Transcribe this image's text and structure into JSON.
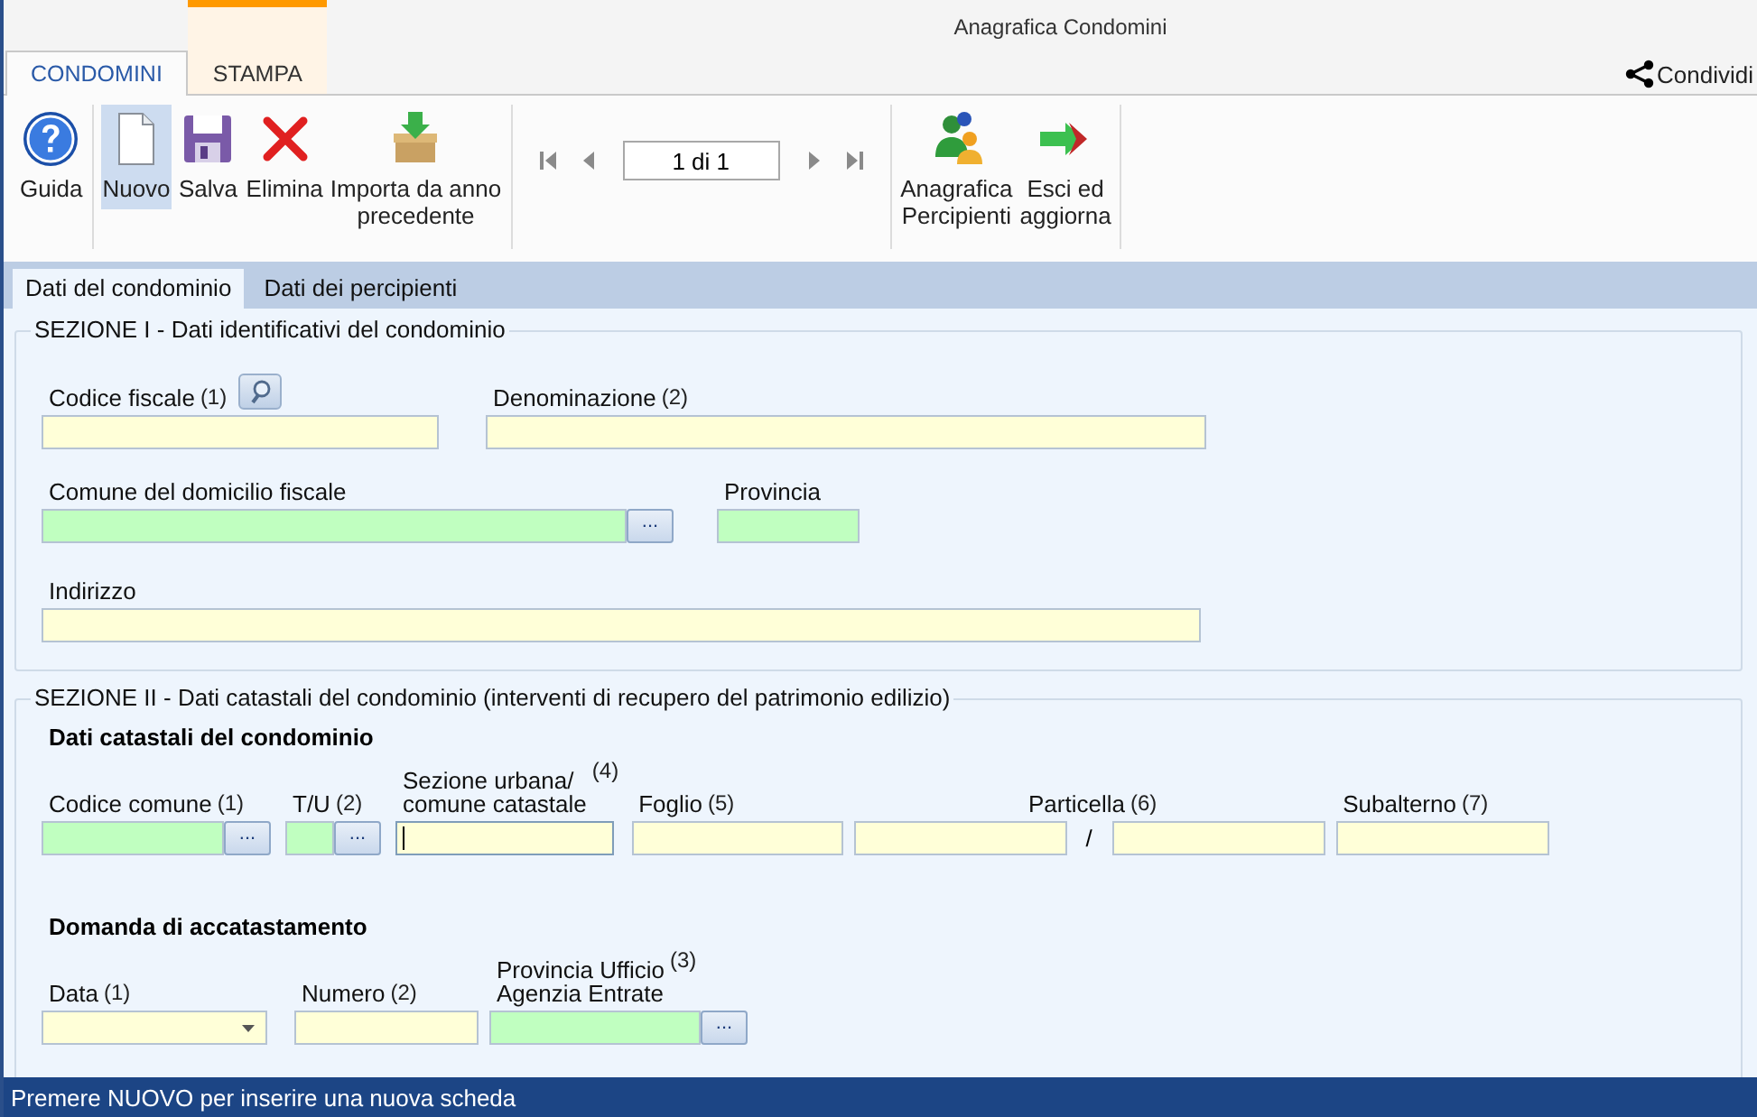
{
  "window": {
    "title": "Anagrafica Condomini"
  },
  "ribbon_tabs": [
    {
      "label": "CONDOMINI",
      "selected": true,
      "accent": false
    },
    {
      "label": "STAMPA",
      "selected": false,
      "accent": true
    }
  ],
  "share": {
    "label": "Condividi"
  },
  "toolbar_groups": [
    {
      "kind": "buttons",
      "buttons": [
        {
          "label": "Guida",
          "pressed": false
        }
      ]
    },
    {
      "kind": "buttons",
      "buttons": [
        {
          "label": "Nuovo",
          "pressed": true
        },
        {
          "label": "Salva",
          "pressed": false
        },
        {
          "label": "Elimina",
          "pressed": false
        },
        {
          "label": "Importa da anno\nprecedente",
          "pressed": false
        }
      ]
    },
    {
      "kind": "pager",
      "value": "1 di 1"
    },
    {
      "kind": "buttons",
      "buttons": [
        {
          "label": "Anagrafica\nPercipienti",
          "pressed": false
        },
        {
          "label": "Esci ed\naggiorna",
          "pressed": false
        }
      ]
    }
  ],
  "form_tabs": [
    {
      "label": "Dati del condominio",
      "selected": true
    },
    {
      "label": "Dati dei percipienti",
      "selected": false
    }
  ],
  "sections": [
    {
      "title": "SEZIONE I - Dati identificativi del condominio",
      "groups": [
        {
          "rows": [
            [
              {
                "label": "Codice fiscale",
                "note": "(1)",
                "kind": "search",
                "color": "#ffffd8",
                "focused": false
              },
              {
                "label": "Denominazione",
                "note": "(2)",
                "kind": "text",
                "color": "#ffffd8",
                "focused": false
              }
            ],
            [
              {
                "label": "Comune del domicilio fiscale",
                "kind": "lookup",
                "button": "...",
                "color": "#c0ffc0",
                "focused": false
              },
              {
                "label": "Provincia",
                "kind": "text",
                "color": "#c0ffc0",
                "focused": false
              }
            ],
            [
              {
                "label": "Indirizzo",
                "kind": "text",
                "color": "#ffffd8",
                "focused": false
              }
            ]
          ]
        }
      ]
    },
    {
      "title": "SEZIONE II - Dati catastali del condominio (interventi di recupero del patrimonio edilizio)",
      "groups": [
        {
          "heading": "Dati catastali del condominio",
          "rows": [
            [
              {
                "label": "Codice comune",
                "note": "(1)",
                "kind": "lookup",
                "button": "...",
                "color": "#c0ffc0",
                "focused": false
              },
              {
                "label": "T/U",
                "note": "(2)",
                "kind": "lookup",
                "button": "...",
                "color": "#c0ffc0",
                "focused": false
              },
              {
                "label": "Sezione urbana/\ncomune catastale",
                "note": "(4)",
                "kind": "text",
                "color": "#ffffd8",
                "focused": true
              },
              {
                "label": "Foglio",
                "note": "(5)",
                "kind": "text",
                "color": "#ffffd8",
                "focused": false
              },
              {
                "label": "Particella",
                "note": "(6)",
                "kind": "split",
                "separator": "/",
                "color": "#ffffd8",
                "focused": false
              },
              {
                "label": "Subalterno",
                "note": "(7)",
                "kind": "text",
                "color": "#ffffd8",
                "focused": false
              }
            ]
          ]
        },
        {
          "heading": "Domanda di accatastamento",
          "rows": [
            [
              {
                "label": "Data",
                "note": "(1)",
                "kind": "date",
                "color": "#ffffd8",
                "focused": false
              },
              {
                "label": "Numero",
                "note": "(2)",
                "kind": "text",
                "color": "#ffffd8",
                "focused": false
              },
              {
                "label": "Provincia Ufficio\nAgenzia Entrate",
                "note": "(3)",
                "kind": "lookup",
                "button": "...",
                "color": "#c0ffc0",
                "focused": false
              }
            ]
          ]
        }
      ]
    }
  ],
  "status_bar": {
    "text": "Premere NUOVO per inserire una nuova scheda"
  }
}
